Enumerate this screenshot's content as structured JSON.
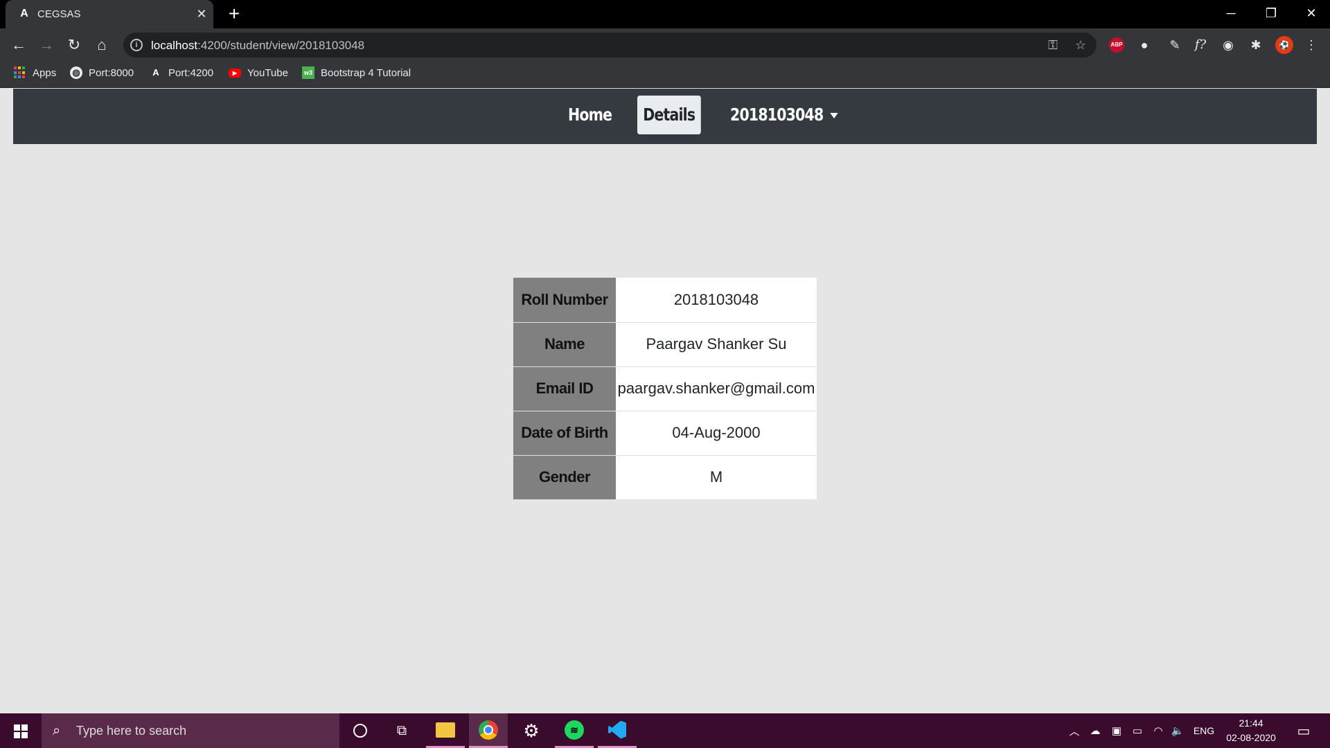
{
  "browser": {
    "tab_title": "CEGSAS",
    "tab_favicon": "A",
    "url_host": "localhost",
    "url_path": ":4200/student/view/2018103048"
  },
  "bookmarks": [
    {
      "label": "Apps"
    },
    {
      "label": "Port:8000"
    },
    {
      "label": "Port:4200"
    },
    {
      "label": "YouTube"
    },
    {
      "label": "Bootstrap 4 Tutorial"
    }
  ],
  "navbar": {
    "home": "Home",
    "details": "Details",
    "user": "2018103048"
  },
  "student": {
    "rows": [
      {
        "label": "Roll Number",
        "value": "2018103048"
      },
      {
        "label": "Name",
        "value": "Paargav Shanker Su"
      },
      {
        "label": "Email ID",
        "value": "paargav.shanker@gmail.com"
      },
      {
        "label": "Date of Birth",
        "value": "04-Aug-2000"
      },
      {
        "label": "Gender",
        "value": "M"
      }
    ]
  },
  "extensions": {
    "abp_label": "ABP"
  },
  "taskbar": {
    "search_placeholder": "Type here to search",
    "language": "ENG",
    "time": "21:44",
    "date": "02-08-2020"
  },
  "colors": {
    "navbar_bg": "#343a40",
    "label_cell_bg": "#808080",
    "taskbar_bg": "#3a0b2c",
    "page_bg": "#e5e5e5"
  }
}
